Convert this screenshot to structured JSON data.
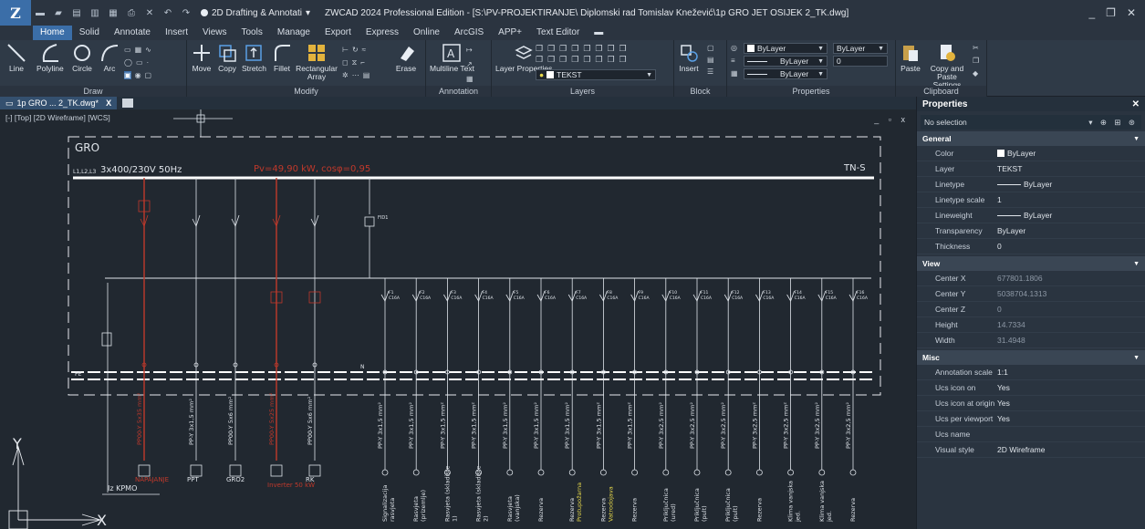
{
  "window": {
    "workspace": "2D Drafting & Annotati",
    "title": "ZWCAD 2024 Professional Edition - [S:\\PV-PROJEKTIRANJE\\ Diplomski rad Tomislav Knežević\\1p GRO JET OSIJEK 2_TK.dwg]",
    "minimize": "_",
    "restore": "❐",
    "close": "✕"
  },
  "ribbon_tabs": [
    "Home",
    "Solid",
    "Annotate",
    "Insert",
    "Views",
    "Tools",
    "Manage",
    "Export",
    "Express",
    "Online",
    "ArcGIS",
    "APP+",
    "Text Editor"
  ],
  "ribbon": {
    "draw": {
      "title": "Draw",
      "line": "Line",
      "polyline": "Polyline",
      "circle": "Circle",
      "arc": "Arc"
    },
    "modify": {
      "title": "Modify",
      "move": "Move",
      "copy": "Copy",
      "stretch": "Stretch",
      "fillet": "Fillet",
      "array": "Rectangular Array",
      "erase": "Erase"
    },
    "annotation": {
      "title": "Annotation",
      "mtext": "Multiline Text"
    },
    "layers": {
      "title": "Layers",
      "layer_props": "Layer Properties",
      "current_layer": "TEKST"
    },
    "block": {
      "title": "Block",
      "insert": "Insert"
    },
    "properties": {
      "title": "Properties",
      "color": "ByLayer",
      "linetype": "ByLayer",
      "lineweight": "ByLayer",
      "plotstyle": "ByLayer",
      "transparency": "0"
    },
    "clipboard": {
      "title": "Clipboard",
      "paste": "Paste",
      "copy_paste_settings": "Copy and Paste Settings"
    }
  },
  "doc_tab": {
    "label": "1p GRO ... 2_TK.dwg*",
    "close": "X"
  },
  "viewport": {
    "label": "[-] [Top] [2D Wireframe] [WCS]",
    "controls": "_ ▫ x"
  },
  "drawing": {
    "frame_title": "GRO",
    "supply": "3x400/230V 50Hz",
    "bus_label": "L1,L2,L3",
    "system": "TN-S",
    "pv_label": "Pv=49,90 kW, cosφ=0,95",
    "n_label": "N",
    "pe_label": "PE",
    "in_label": "Iz KPMO",
    "wire_main": "PP00-Y 5x35 mm²",
    "left_loads": [
      {
        "cable": "PP00-Y 5x35 mm²",
        "label": "NAPAJANJE",
        "color": "red"
      },
      {
        "cable": "PP-Y 3x1,5 mm²",
        "label": "PPT",
        "color": "white"
      },
      {
        "cable": "PP00-Y 5x6 mm²",
        "label": "GRO2",
        "color": "white"
      },
      {
        "cable": "PP00-Y 5x25 mm²",
        "label": "Inverter 50 kW",
        "color": "red"
      },
      {
        "cable": "PP00-Y 5x6 mm²",
        "label": "RK",
        "color": "white"
      }
    ],
    "circuits": [
      {
        "id": "F1",
        "cable": "PP-Y 3x1,5 mm²",
        "label": "Signalizacija rasvjeta"
      },
      {
        "id": "F2",
        "cable": "PP-Y 3x1,5 mm²",
        "label": "Rasvjeta (prizemlje)"
      },
      {
        "id": "F3",
        "cable": "PP-Y 3x1,5 mm²",
        "label": "Rasvjeta (skladište 1)"
      },
      {
        "id": "F4",
        "cable": "PP-Y 3x1,5 mm²",
        "label": "Rasvjeta (skladište 2)"
      },
      {
        "id": "F5",
        "cable": "PP-Y 3x1,5 mm²",
        "label": "Rasvjeta (vanjska)"
      },
      {
        "id": "F6",
        "cable": "PP-Y 3x1,5 mm²",
        "label": "Rezerva"
      },
      {
        "id": "F7",
        "cable": "PP-Y 3x1,5 mm²",
        "label": "Rezerva Protupožarna"
      },
      {
        "id": "F8",
        "cable": "PP-Y 3x1,5 mm²",
        "label": "Rezerva Vatrodojava"
      },
      {
        "id": "F9",
        "cable": "PP-Y 3x1,5 mm²",
        "label": "Rezerva"
      },
      {
        "id": "F10",
        "cable": "PP-Y 3x2,5 mm²",
        "label": "Priključnica (ured)"
      },
      {
        "id": "F11",
        "cable": "PP-Y 3x2,5 mm²",
        "label": "Priključnica (pult)"
      },
      {
        "id": "F12",
        "cable": "PP-Y 3x2,5 mm²",
        "label": "Priključnica (pult)"
      },
      {
        "id": "F13",
        "cable": "PP-Y 3x2,5 mm²",
        "label": "Rezerva"
      },
      {
        "id": "F14",
        "cable": "PP-Y 3x2,5 mm²",
        "label": "Klima vanjska jed."
      },
      {
        "id": "F15",
        "cable": "PP-Y 3x2,5 mm²",
        "label": "Klima vanjska jed."
      },
      {
        "id": "F16",
        "cable": "PP-Y 3x2,5 mm²",
        "label": "Rezerva"
      }
    ],
    "breaker_rating": "C16A",
    "rcd_label": "FID1",
    "ucs_x": "X",
    "ucs_y": "Y"
  },
  "properties_panel": {
    "title": "Properties",
    "selection": "No selection",
    "sections": [
      {
        "name": "General",
        "rows": [
          {
            "name": "Color",
            "value": "ByLayer",
            "swatch": true
          },
          {
            "name": "Layer",
            "value": "TEKST"
          },
          {
            "name": "Linetype",
            "value": "ByLayer",
            "line": true
          },
          {
            "name": "Linetype scale",
            "value": "1"
          },
          {
            "name": "Lineweight",
            "value": "ByLayer",
            "line": true
          },
          {
            "name": "Transparency",
            "value": "ByLayer"
          },
          {
            "name": "Thickness",
            "value": "0"
          }
        ]
      },
      {
        "name": "View",
        "rows": [
          {
            "name": "Center X",
            "value": "677801.1806",
            "dim": true
          },
          {
            "name": "Center Y",
            "value": "5038704.1313",
            "dim": true
          },
          {
            "name": "Center Z",
            "value": "0",
            "dim": true
          },
          {
            "name": "Height",
            "value": "14.7334",
            "dim": true
          },
          {
            "name": "Width",
            "value": "31.4948",
            "dim": true
          }
        ]
      },
      {
        "name": "Misc",
        "rows": [
          {
            "name": "Annotation scale",
            "value": "1:1"
          },
          {
            "name": "Ucs icon on",
            "value": "Yes"
          },
          {
            "name": "Ucs icon at origin",
            "value": "Yes"
          },
          {
            "name": "Ucs per viewport",
            "value": "Yes"
          },
          {
            "name": "Ucs name",
            "value": ""
          },
          {
            "name": "Visual style",
            "value": "2D Wireframe"
          }
        ]
      }
    ]
  },
  "colors": {
    "accent": "#3b6ea8",
    "red_circuit": "#c0392b",
    "yellow": "#e6d84a"
  }
}
